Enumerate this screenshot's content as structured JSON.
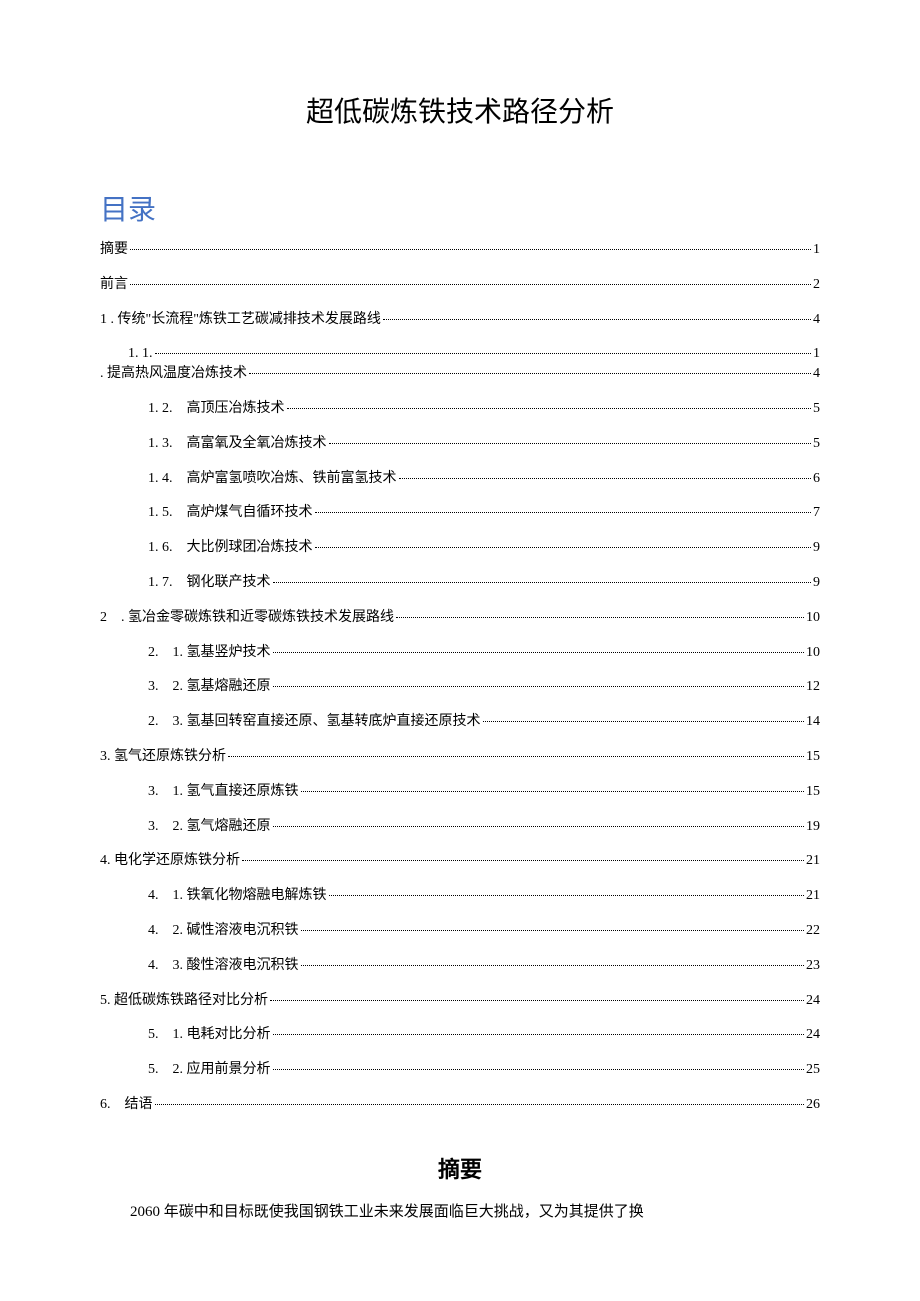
{
  "title": "超低碳炼铁技术路径分析",
  "toc_label": "目录",
  "toc": [
    {
      "label": "摘要",
      "page": "1",
      "indent": "ind0"
    },
    {
      "label": "前言",
      "page": "2",
      "indent": "ind0"
    },
    {
      "label": "1 . 传统\"长流程\"炼铁工艺碳减排技术发展路线 ",
      "page": "4",
      "indent": "ind0"
    },
    {
      "label": "1. 1. ",
      "page": "1",
      "indent": "ind1",
      "tight": true
    },
    {
      "label": ". 提高热风温度冶炼技术",
      "page": "4",
      "indent": "ind1b"
    },
    {
      "label": "1. 2.　高顶压冶炼技术 ",
      "page": "5",
      "indent": "ind2"
    },
    {
      "label": "1. 3.　高富氧及全氧冶炼技术 ",
      "page": "5",
      "indent": "ind2"
    },
    {
      "label": "1. 4.　高炉富氢喷吹冶炼、铁前富氢技术 ",
      "page": "6",
      "indent": "ind2"
    },
    {
      "label": "1. 5.　高炉煤气自循环技术 ",
      "page": "7",
      "indent": "ind2"
    },
    {
      "label": "1. 6.　大比例球团冶炼技术 ",
      "page": "9",
      "indent": "ind2"
    },
    {
      "label": "1. 7.　钢化联产技术 ",
      "page": "9",
      "indent": "ind2"
    },
    {
      "label": "2　. 氢冶金零碳炼铁和近零碳炼铁技术发展路线",
      "page": "10",
      "indent": "ind0"
    },
    {
      "label": "2.　1. 氢基竖炉技术 ",
      "page": "10",
      "indent": "ind2"
    },
    {
      "label": "3.　2. 氢基熔融还原 ",
      "page": "12",
      "indent": "ind2"
    },
    {
      "label": "2.　3. 氢基回转窑直接还原、氢基转底炉直接还原技术",
      "page": "14",
      "indent": "ind2"
    },
    {
      "label": "3. 氢气还原炼铁分析",
      "page": "15",
      "indent": "ind0"
    },
    {
      "label": "3.　1. 氢气直接还原炼铁 ",
      "page": "15",
      "indent": "ind2"
    },
    {
      "label": "3.　2. 氢气熔融还原 ",
      "page": "19",
      "indent": "ind2"
    },
    {
      "label": "4. 电化学还原炼铁分析",
      "page": "21",
      "indent": "ind0"
    },
    {
      "label": "4.　1. 铁氧化物熔融电解炼铁 ",
      "page": "21",
      "indent": "ind2"
    },
    {
      "label": "4.　2. 碱性溶液电沉积铁 ",
      "page": "22",
      "indent": "ind2"
    },
    {
      "label": "4.　3. 酸性溶液电沉积铁 ",
      "page": "23",
      "indent": "ind2"
    },
    {
      "label": "5. 超低碳炼铁路径对比分析",
      "page": "24",
      "indent": "ind0"
    },
    {
      "label": "5.　1. 电耗对比分析 ",
      "page": "24",
      "indent": "ind2"
    },
    {
      "label": "5.　2. 应用前景分析 ",
      "page": "25",
      "indent": "ind2"
    },
    {
      "label": "6.　结语 ",
      "page": "26",
      "indent": "ind0"
    }
  ],
  "abstract": {
    "heading": "摘要",
    "body": "2060 年碳中和目标既使我国钢铁工业未来发展面临巨大挑战，又为其提供了换"
  }
}
